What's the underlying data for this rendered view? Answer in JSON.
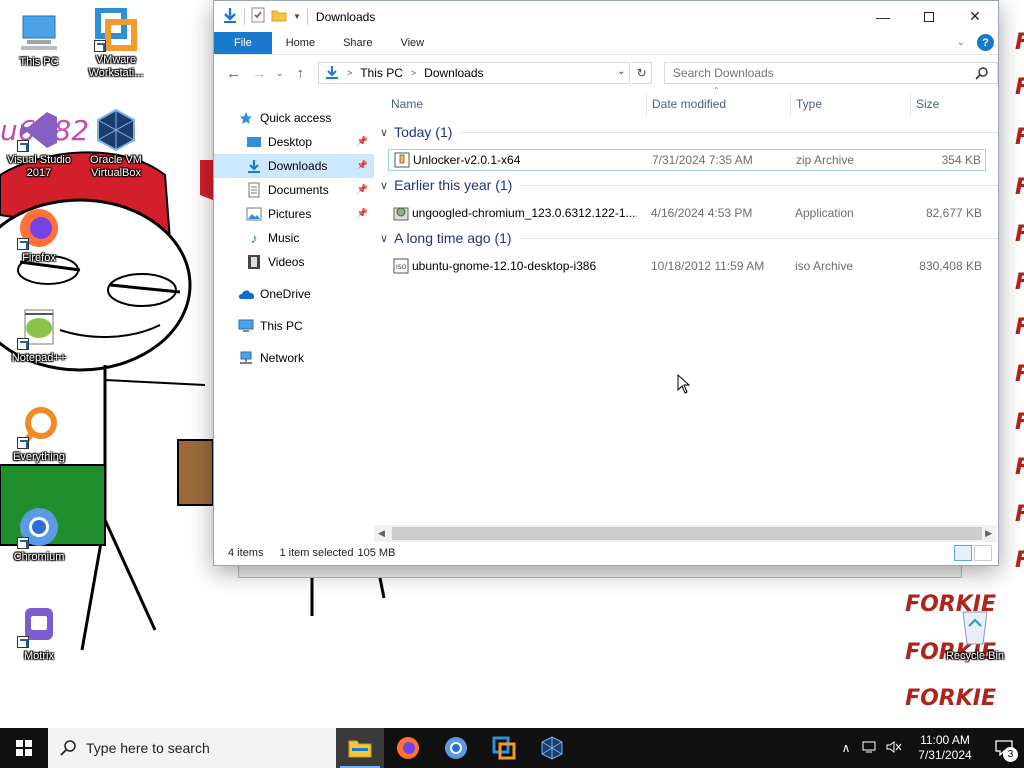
{
  "desktop": {
    "icons": [
      {
        "label": "This PC",
        "icon": "this-pc-icon"
      },
      {
        "label": "VMware Workstati...",
        "icon": "vmware-icon"
      },
      {
        "label": "Visual Studio 2017",
        "icon": "visual-studio-icon"
      },
      {
        "label": "Oracle VM VirtualBox",
        "icon": "virtualbox-icon"
      },
      {
        "label": "Firefox",
        "icon": "firefox-icon"
      },
      {
        "label": "Notepad++",
        "icon": "notepadpp-icon"
      },
      {
        "label": "Everything",
        "icon": "everything-icon"
      },
      {
        "label": "Chromium",
        "icon": "chromium-icon"
      },
      {
        "label": "Motrix",
        "icon": "motrix-icon"
      },
      {
        "label": "Recycle Bin",
        "icon": "recycle-bin-icon"
      }
    ],
    "wallpaper_text": "FORKIE",
    "scribble_text": "u6182 9"
  },
  "window": {
    "title": "Downloads",
    "ribbon_tabs": [
      "File",
      "Home",
      "Share",
      "View"
    ],
    "address": {
      "crumbs": [
        "This PC",
        "Downloads"
      ]
    },
    "search": {
      "placeholder": "Search Downloads"
    },
    "columns": [
      "Name",
      "Date modified",
      "Type",
      "Size"
    ],
    "nav_pane": [
      {
        "label": "Quick access",
        "icon": "star-icon",
        "pinned": false,
        "selected": false
      },
      {
        "label": "Desktop",
        "icon": "desktop-folder-icon",
        "pinned": true,
        "selected": false
      },
      {
        "label": "Downloads",
        "icon": "download-arrow-icon",
        "pinned": true,
        "selected": true
      },
      {
        "label": "Documents",
        "icon": "documents-icon",
        "pinned": true,
        "selected": false
      },
      {
        "label": "Pictures",
        "icon": "pictures-icon",
        "pinned": true,
        "selected": false
      },
      {
        "label": "Music",
        "icon": "music-icon",
        "pinned": false,
        "selected": false
      },
      {
        "label": "Videos",
        "icon": "videos-icon",
        "pinned": false,
        "selected": false
      },
      {
        "label": "OneDrive",
        "icon": "onedrive-icon",
        "pinned": false,
        "selected": false
      },
      {
        "label": "This PC",
        "icon": "this-pc-icon",
        "pinned": false,
        "selected": false
      },
      {
        "label": "Network",
        "icon": "network-icon",
        "pinned": false,
        "selected": false
      }
    ],
    "groups": [
      {
        "label": "Today (1)",
        "files": [
          {
            "name": "Unlocker-v2.0.1-x64",
            "date": "7/31/2024 7:35 AM",
            "type": "zip Archive",
            "size": "354 KB",
            "icon": "zip-archive-icon",
            "selected": true
          }
        ]
      },
      {
        "label": "Earlier this year (1)",
        "files": [
          {
            "name": "ungoogled-chromium_123.0.6312.122-1....",
            "date": "4/16/2024 4:53 PM",
            "type": "Application",
            "size": "82,677 KB",
            "icon": "installer-icon",
            "selected": false
          }
        ]
      },
      {
        "label": "A long time ago (1)",
        "files": [
          {
            "name": "ubuntu-gnome-12.10-desktop-i386",
            "date": "10/18/2012 11:59 AM",
            "type": "iso Archive",
            "size": "830,408 KB",
            "icon": "iso-archive-icon",
            "selected": false
          }
        ]
      }
    ],
    "status": {
      "items": "4 items",
      "selected": "1 item selected",
      "size": "105 MB"
    }
  },
  "taskbar": {
    "search_placeholder": "Type here to search",
    "apps": [
      "file-explorer-icon",
      "firefox-icon",
      "chromium-icon",
      "vmware-icon",
      "virtualbox-icon"
    ],
    "clock": {
      "time": "11:00 AM",
      "date": "7/31/2024"
    },
    "notification_count": "3"
  },
  "colors": {
    "accent": "#1979ca",
    "selection": "#cce8ff",
    "group_header": "#1e3287",
    "taskbar": "#101010"
  }
}
